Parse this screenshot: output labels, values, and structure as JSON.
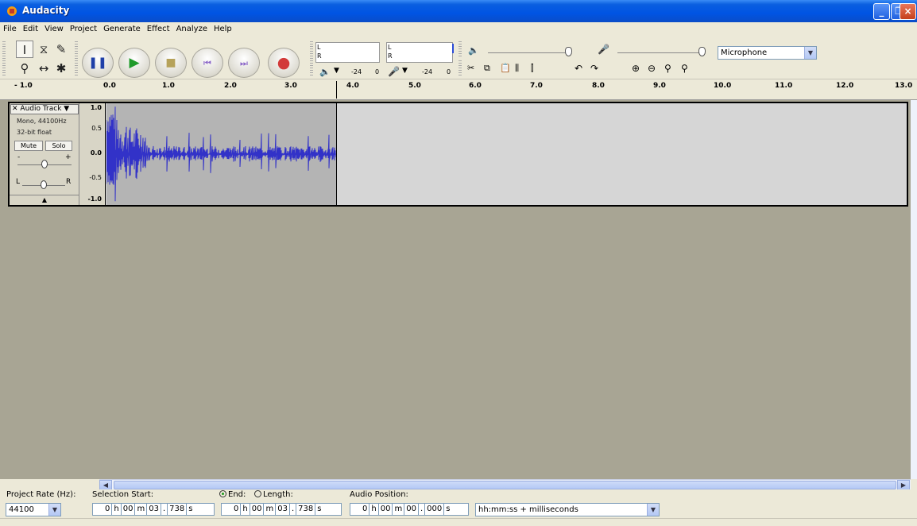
{
  "window": {
    "title": "Audacity"
  },
  "menu": [
    "File",
    "Edit",
    "View",
    "Project",
    "Generate",
    "Effect",
    "Analyze",
    "Help"
  ],
  "tools": {
    "selection": "selection-tool",
    "envelope": "envelope-tool",
    "draw": "draw-tool",
    "zoom": "zoom-tool",
    "timeshift": "timeshift-tool",
    "multi": "multi-tool"
  },
  "meters": {
    "play_l": "L",
    "play_r": "R",
    "rec_l": "L",
    "rec_r": "R",
    "play_db_min": "-24",
    "play_db_max": "0",
    "rec_db_min": "-24",
    "rec_db_max": "0"
  },
  "input_source": "Microphone",
  "ruler": {
    "labels": [
      "- 1.0",
      "0.0",
      "1.0",
      "2.0",
      "3.0",
      "4.0",
      "5.0",
      "6.0",
      "7.0",
      "8.0",
      "9.0",
      "10.0",
      "11.0",
      "12.0",
      "13.0"
    ]
  },
  "track": {
    "name": "Audio Track",
    "format": "Mono, 44100Hz",
    "bit_depth": "32-bit float",
    "mute_label": "Mute",
    "solo_label": "Solo",
    "gain_minus": "-",
    "gain_plus": "+",
    "pan_left": "L",
    "pan_right": "R",
    "scale": [
      "1.0",
      "0.5",
      "0.0",
      "-0.5",
      "-1.0"
    ]
  },
  "selection_bar": {
    "project_rate_label": "Project Rate (Hz):",
    "project_rate": "44100",
    "selection_start_label": "Selection Start:",
    "end_label": "End:",
    "length_label": "Length:",
    "audio_position_label": "Audio Position:",
    "start": {
      "h": "0",
      "m": "00",
      "s": "03",
      "ms": "738"
    },
    "end": {
      "h": "0",
      "m": "00",
      "s": "03",
      "ms": "738"
    },
    "position": {
      "h": "0",
      "m": "00",
      "s": "00",
      "ms": "000"
    },
    "unit_h": "h",
    "unit_m": "m",
    "unit_s": "s",
    "time_format": "hh:mm:ss + milliseconds"
  },
  "colors": {
    "waveform": "#3232c8",
    "titlebar": "#0054e3",
    "background": "#a8a594"
  }
}
